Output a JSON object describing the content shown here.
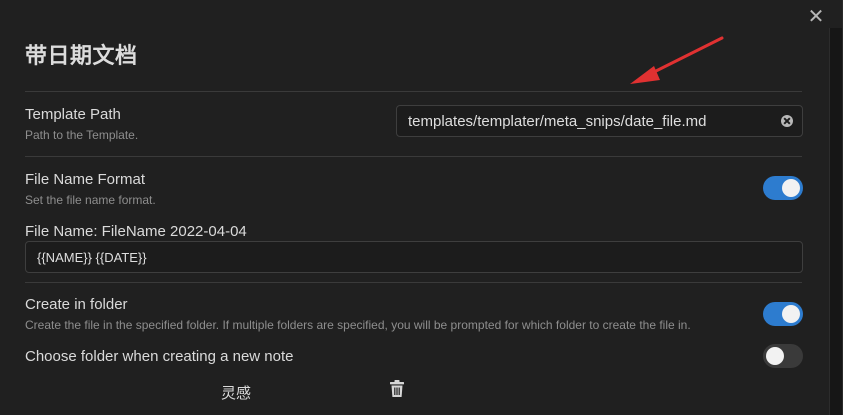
{
  "dialog": {
    "title": "带日期文档",
    "close_symbol": "✕"
  },
  "template_path": {
    "label": "Template Path",
    "description": "Path to the Template.",
    "value": "templates/templater/meta_snips/date_file.md"
  },
  "file_name_format": {
    "label": "File Name Format",
    "description": "Set the file name format.",
    "enabled": true,
    "preview_label": "File Name: FileName 2022-04-04",
    "value": "{{NAME}} {{DATE}}"
  },
  "create_in_folder": {
    "label": "Create in folder",
    "description": "Create the file in the specified folder. If multiple folders are specified, you will be prompted for which folder to create the file in.",
    "enabled": true
  },
  "choose_folder": {
    "label": "Choose folder when creating a new note",
    "enabled": false
  },
  "folders": [
    {
      "name": "灵感",
      "delete_icon": "trash-icon"
    }
  ],
  "colors": {
    "toggle_on": "#2d7ccf",
    "annotation_arrow": "#e03131"
  }
}
